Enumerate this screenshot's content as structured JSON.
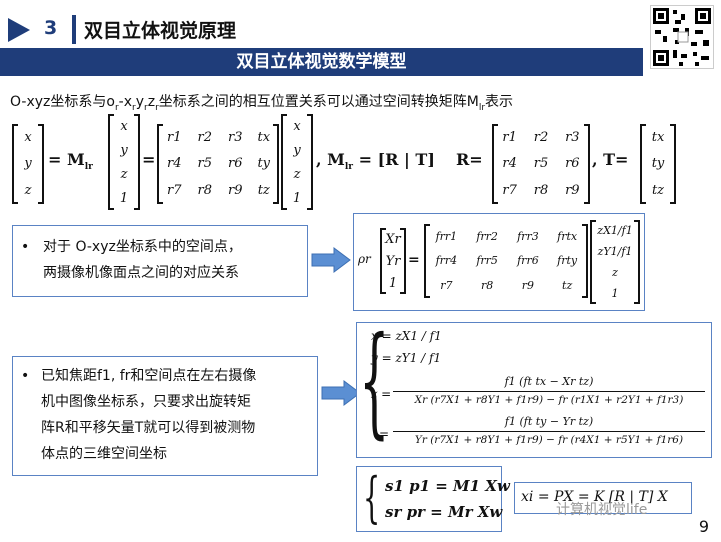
{
  "header": {
    "section_number": "3",
    "section_title": "双目立体视觉原理",
    "banner_title": "双目立体视觉数学模型"
  },
  "intro": {
    "part1": "O-xyz坐标系与o",
    "sub_r1": "r",
    "part2": "-x",
    "sub_r2": "r",
    "part3": "y",
    "sub_r3": "r",
    "part4": "z",
    "sub_r4": "r",
    "part5": "坐标系之间的相互位置关系可以通过空间转换矩阵M",
    "sub_lr": "lr",
    "part6": "表示"
  },
  "equation1": {
    "lhs": [
      "x",
      "y",
      "z"
    ],
    "lhs_sub": "r",
    "m_label": "M",
    "m_sub": "lr",
    "rows": [
      [
        "r1",
        "r2",
        "r3",
        "tx"
      ],
      [
        "r4",
        "r5",
        "r6",
        "ty"
      ],
      [
        "r7",
        "r8",
        "r9",
        "tz"
      ]
    ],
    "xyz1": [
      "x",
      "y",
      "z",
      "1"
    ],
    "m_eq": "= [R | T]",
    "R_label": "R=",
    "R_rows": [
      [
        "r1",
        "r2",
        "r3"
      ],
      [
        "r4",
        "r5",
        "r6"
      ],
      [
        "r7",
        "r8",
        "r9"
      ]
    ],
    "T_label": "T=",
    "T_rows": [
      "tx",
      "ty",
      "tz"
    ]
  },
  "bullet1": {
    "bullet": "•",
    "line1": "对于 O-xyz坐标系中的空间点，",
    "line2": "两摄像机像面点之间的对应关系"
  },
  "equation2": {
    "rho": "ρr",
    "lhs": [
      "Xr",
      "Yr",
      "1"
    ],
    "rows": [
      [
        "frr1",
        "frr2",
        "frr3",
        "frtx"
      ],
      [
        "frr4",
        "frr5",
        "frr6",
        "frty"
      ],
      [
        "r7",
        "r8",
        "r9",
        "tz"
      ]
    ],
    "rhs": [
      "zX1/f1",
      "zY1/f1",
      "z",
      "1"
    ]
  },
  "bullet2": {
    "bullet": "•",
    "lines": [
      "已知焦距f1, fr和空间点在左右摄像",
      "机中图像坐标系，只要求出旋转矩",
      "阵R和平移矢量T就可以得到被测物",
      "体点的三维空间坐标"
    ]
  },
  "equation3": {
    "l1": "x = zX1 / f1",
    "l2": "y = zY1 / f1",
    "l3_num": "f1 (ft tx − Xr tz)",
    "l3_den": "Xr (r7X1 + r8Y1 + f1r9) − fr (r1X1 + r2Y1 + f1r3)",
    "l4_num": "f1 (ft ty − Yr tz)",
    "l4_den": "Yr (r7X1 + r8Y1 + f1r9) − fr (r4X1 + r5Y1 + f1r6)",
    "z_label": "z ="
  },
  "equation4": {
    "l1": "s1 p1 = M1 Xw",
    "l2": "sr pr = Mr Xw"
  },
  "equation5": {
    "text": "xi = PX = K [R | T] X"
  },
  "watermark": "计算机视觉life",
  "page_number": "9"
}
